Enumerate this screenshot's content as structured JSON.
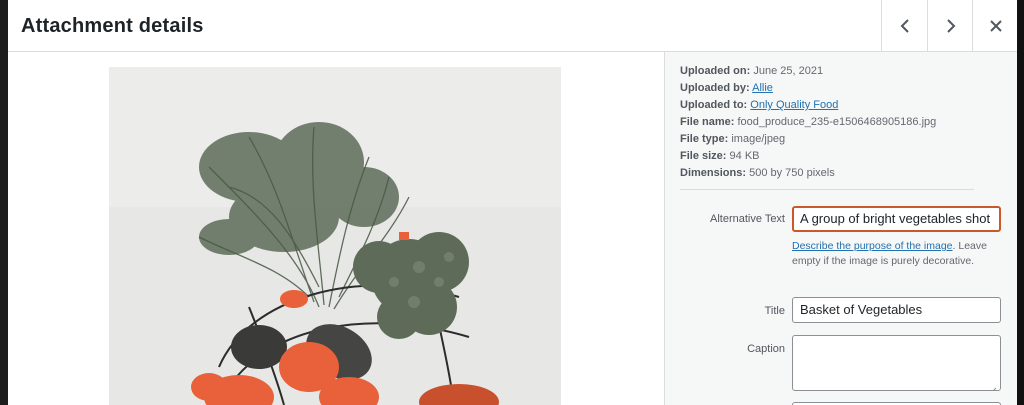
{
  "header": {
    "title": "Attachment details",
    "prev_icon": "chevron-left-icon",
    "next_icon": "chevron-right-icon",
    "close_icon": "close-icon"
  },
  "details": {
    "uploaded_on_label": "Uploaded on:",
    "uploaded_on": "June 25, 2021",
    "uploaded_by_label": "Uploaded by:",
    "uploaded_by": "Allie",
    "uploaded_to_label": "Uploaded to:",
    "uploaded_to": "Only Quality Food",
    "file_name_label": "File name:",
    "file_name": "food_produce_235-e1506468905186.jpg",
    "file_type_label": "File type:",
    "file_type": "image/jpeg",
    "file_size_label": "File size:",
    "file_size": "94 KB",
    "dimensions_label": "Dimensions:",
    "dimensions": "500 by 750 pixels"
  },
  "form": {
    "alt_label": "Alternative Text",
    "alt_value": "A group of bright vegetables shot",
    "alt_help_link": "Describe the purpose of the image",
    "alt_help_text": ". Leave empty if the image is purely decorative.",
    "title_label": "Title",
    "title_value": "Basket of Vegetables",
    "caption_label": "Caption",
    "caption_value": ""
  },
  "colors": {
    "focus_border": "#c9582b",
    "link": "#2271b1",
    "pepper": "#e8613a"
  }
}
